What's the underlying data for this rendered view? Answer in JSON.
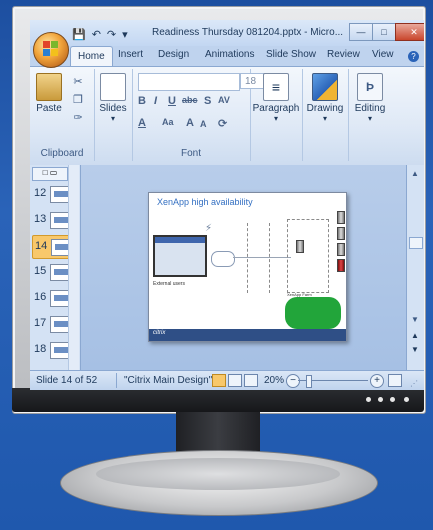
{
  "window": {
    "title": "Readiness Thursday 081204.pptx - Micro...",
    "controls": [
      "minimize-icon",
      "maximize-icon",
      "close-icon"
    ]
  },
  "quick_access": [
    "save-icon",
    "undo-icon",
    "redo-icon",
    "customize-icon"
  ],
  "tabs": [
    {
      "label": "Home",
      "active": true
    },
    {
      "label": "Insert"
    },
    {
      "label": "Design"
    },
    {
      "label": "Animations"
    },
    {
      "label": "Slide Show"
    },
    {
      "label": "Review"
    },
    {
      "label": "View"
    }
  ],
  "ribbon": {
    "clipboard": {
      "paste_label": "Paste",
      "group_label": "Clipboard"
    },
    "slides": {
      "slides_label": "Slides"
    },
    "font": {
      "group_label": "Font",
      "font_size": "18",
      "grow_label": "A",
      "shrink_label": "A"
    },
    "paragraph": {
      "label": "Paragraph"
    },
    "drawing": {
      "label": "Drawing"
    },
    "editing": {
      "label": "Editing"
    }
  },
  "thumbnails": [
    {
      "num": "12"
    },
    {
      "num": "13"
    },
    {
      "num": "14",
      "selected": true
    },
    {
      "num": "15"
    },
    {
      "num": "16"
    },
    {
      "num": "17"
    },
    {
      "num": "18"
    }
  ],
  "slide": {
    "title": "XenApp high availability",
    "label_users": "External users",
    "label_farm": "XenApp Farm"
  },
  "status": {
    "slide_pos": "Slide 14 of 52",
    "theme": "\"Citrix Main Design\"",
    "zoom": "20%"
  },
  "colors": {
    "accent": "#2a63b8",
    "selected": "#f8c86b",
    "green": "#22a53a"
  }
}
